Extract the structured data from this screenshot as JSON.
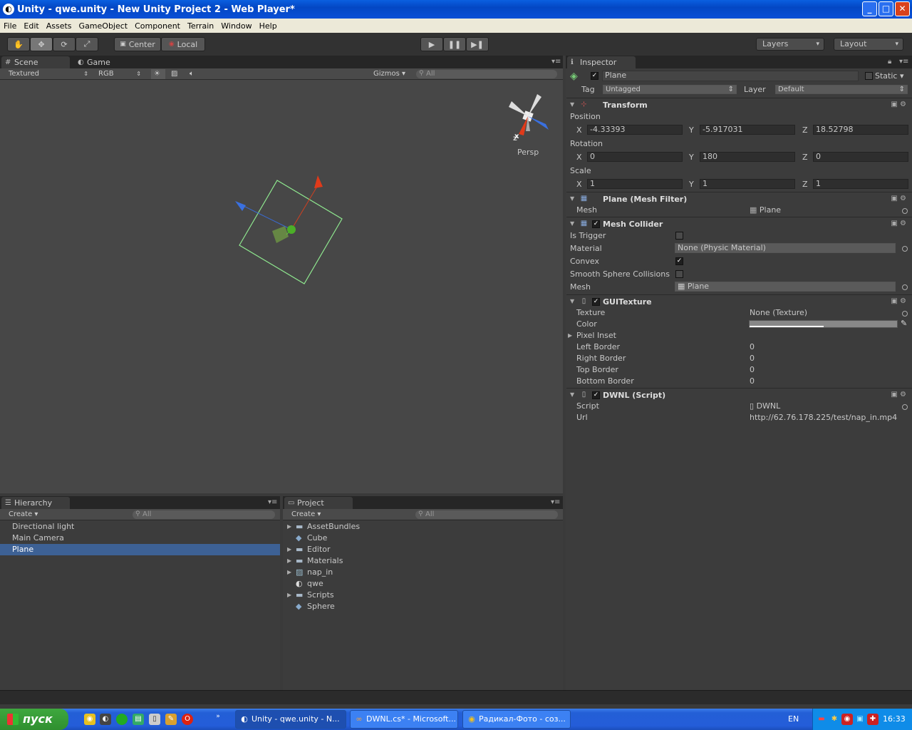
{
  "window": {
    "title": "Unity - qwe.unity - New Unity Project 2 - Web Player*"
  },
  "menu": [
    "File",
    "Edit",
    "Assets",
    "GameObject",
    "Component",
    "Terrain",
    "Window",
    "Help"
  ],
  "toolbar": {
    "pivot_label": "Center",
    "space_label": "Local",
    "layers_label": "Layers",
    "layout_label": "Layout"
  },
  "scene": {
    "tab_scene": "Scene",
    "tab_game": "Game",
    "render_mode": "Textured",
    "color_mode": "RGB",
    "gizmos": "Gizmos",
    "search_placeholder": "All",
    "persp_label": "Persp",
    "axis_x": "x",
    "axis_z": "z"
  },
  "hierarchy": {
    "tab": "Hierarchy",
    "create": "Create",
    "search_placeholder": "All",
    "items": [
      "Directional light",
      "Main Camera",
      "Plane"
    ],
    "selected_index": 2
  },
  "project": {
    "tab": "Project",
    "create": "Create",
    "search_placeholder": "All",
    "items": [
      "AssetBundles",
      "Cube",
      "Editor",
      "Materials",
      "nap_in",
      "qwe",
      "Scripts",
      "Sphere"
    ]
  },
  "inspector": {
    "tab": "Inspector",
    "object_name": "Plane",
    "static_label": "Static",
    "tag_label": "Tag",
    "tag_value": "Untagged",
    "layer_label": "Layer",
    "layer_value": "Default",
    "transform": {
      "title": "Transform",
      "position_label": "Position",
      "rotation_label": "Rotation",
      "scale_label": "Scale",
      "axis_labels": [
        "X",
        "Y",
        "Z"
      ],
      "position": [
        "-4.33393",
        "-5.917031",
        "18.52798"
      ],
      "rotation": [
        "0",
        "180",
        "0"
      ],
      "scale": [
        "1",
        "1",
        "1"
      ]
    },
    "mesh_filter": {
      "title": "Plane (Mesh Filter)",
      "mesh_label": "Mesh",
      "mesh_value": "Plane"
    },
    "mesh_collider": {
      "title": "Mesh Collider",
      "is_trigger_label": "Is Trigger",
      "material_label": "Material",
      "material_value": "None (Physic Material)",
      "convex_label": "Convex",
      "smooth_label": "Smooth Sphere Collisions",
      "mesh_label": "Mesh",
      "mesh_value": "Plane"
    },
    "gui_texture": {
      "title": "GUITexture",
      "texture_label": "Texture",
      "texture_value": "None (Texture)",
      "color_label": "Color",
      "pixel_inset_label": "Pixel Inset",
      "left_border_label": "Left Border",
      "left_border": "0",
      "right_border_label": "Right Border",
      "right_border": "0",
      "top_border_label": "Top Border",
      "top_border": "0",
      "bottom_border_label": "Bottom Border",
      "bottom_border": "0"
    },
    "script": {
      "title": "DWNL (Script)",
      "script_label": "Script",
      "script_value": "DWNL",
      "url_label": "Url",
      "url_value": "http://62.76.178.225/test/nap_in.mp4"
    }
  },
  "taskbar": {
    "start": "пуск",
    "tasks": [
      "Unity - qwe.unity - N...",
      "DWNL.cs* - Microsoft...",
      "Радикал-Фото - соз..."
    ],
    "lang": "EN",
    "clock": "16:33"
  },
  "colors": {
    "selection": "#3d6195",
    "xp_blue": "#245dd9",
    "start_green": "#3ea83e"
  }
}
